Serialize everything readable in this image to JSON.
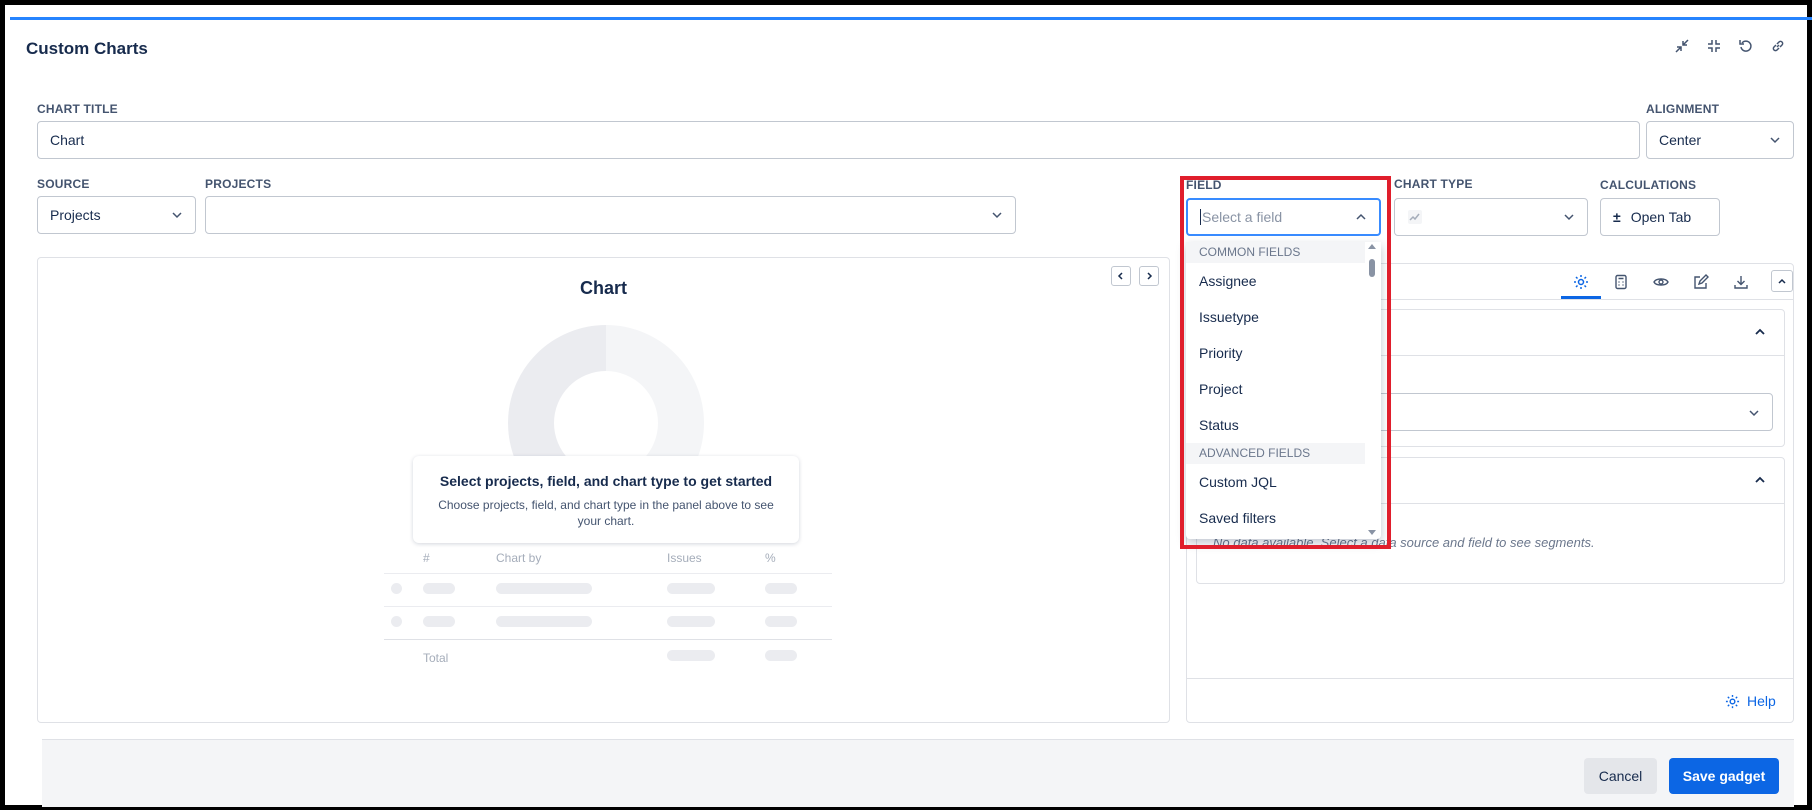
{
  "header": {
    "title": "Custom Charts"
  },
  "form": {
    "chart_title_label": "CHART TITLE",
    "chart_title_value": "Chart",
    "alignment_label": "ALIGNMENT",
    "alignment_value": "Center",
    "source_label": "SOURCE",
    "source_value": "Projects",
    "projects_label": "PROJECTS",
    "projects_value": "",
    "field_label": "FIELD",
    "field_placeholder": "Select a field",
    "chart_type_label": "CHART TYPE",
    "calculations_label": "CALCULATIONS",
    "open_tab_label": "Open Tab",
    "open_tab_symbol": "±"
  },
  "preview": {
    "title": "Chart",
    "empty_heading": "Select projects, field, and chart type to get started",
    "empty_sub": "Choose projects, field, and chart type in the panel above to see your chart.",
    "table_headers": [
      "#",
      "Chart by",
      "Issues",
      "%"
    ],
    "total_label": "Total"
  },
  "dropdown": {
    "common_header": "COMMON FIELDS",
    "common_items": [
      "Assignee",
      "Issuetype",
      "Priority",
      "Project",
      "Status"
    ],
    "advanced_header": "ADVANCED FIELDS",
    "advanced_items": [
      "Custom JQL",
      "Saved filters"
    ]
  },
  "settings": {
    "no_data_text": "No data available. Select a data source and field to see segments.",
    "help_label": "Help"
  },
  "footer": {
    "cancel_label": "Cancel",
    "save_label": "Save gadget"
  },
  "colors": {
    "accent": "#0c66e4",
    "highlight": "#e01e2c",
    "topline": "#2684ff"
  }
}
